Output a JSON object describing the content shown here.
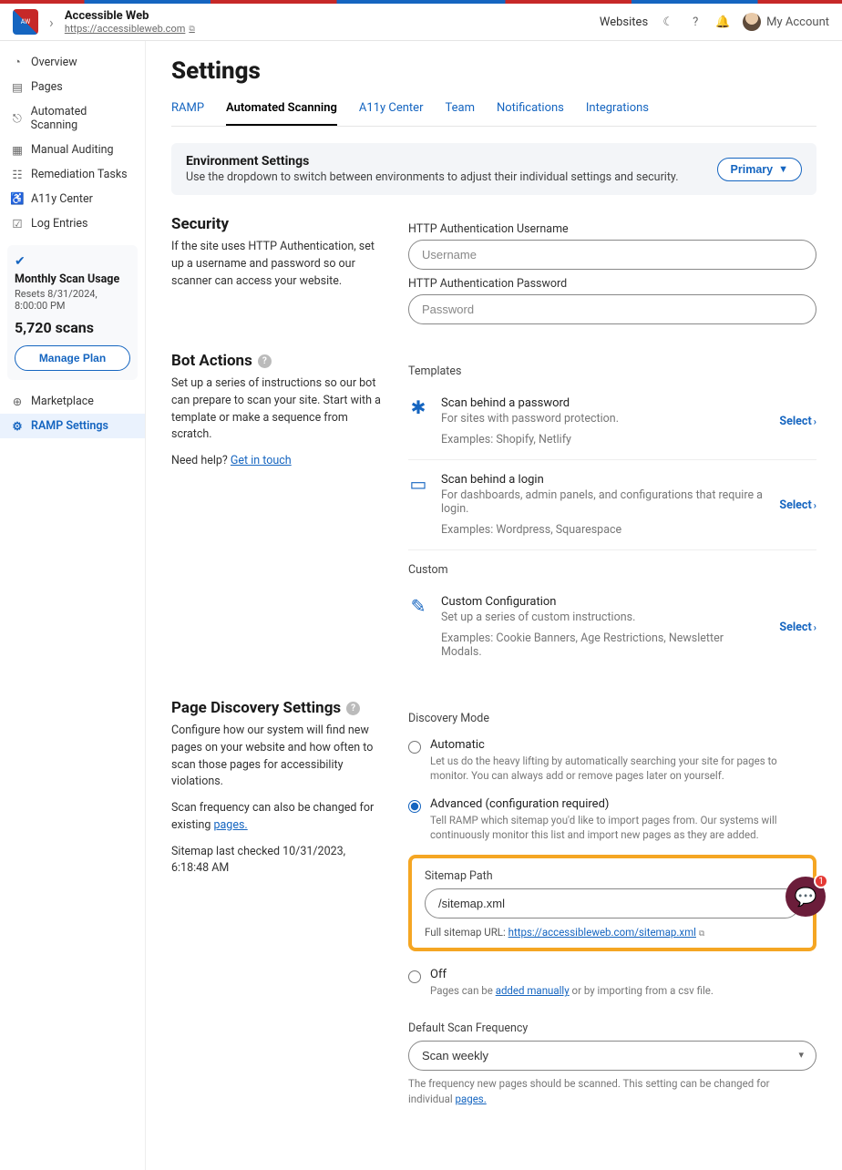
{
  "header": {
    "site_name": "Accessible Web",
    "site_url": "https://accessibleweb.com",
    "websites_link": "Websites",
    "my_account": "My Account"
  },
  "sidebar": {
    "items": [
      {
        "label": "Overview",
        "icon": "◔"
      },
      {
        "label": "Pages",
        "icon": "▤"
      },
      {
        "label": "Automated Scanning",
        "icon": "⎋"
      },
      {
        "label": "Manual Auditing",
        "icon": "▦"
      },
      {
        "label": "Remediation Tasks",
        "icon": "☷"
      },
      {
        "label": "A11y Center",
        "icon": "♿"
      },
      {
        "label": "Log Entries",
        "icon": "☑"
      }
    ],
    "marketplace": "Marketplace",
    "ramp_settings": "RAMP Settings",
    "usage": {
      "title": "Monthly Scan Usage",
      "resets": "Resets 8/31/2024, 8:00:00 PM",
      "scans": "5,720 scans",
      "manage": "Manage Plan"
    }
  },
  "page": {
    "title": "Settings",
    "tabs": [
      "RAMP",
      "Automated Scanning",
      "A11y Center",
      "Team",
      "Notifications",
      "Integrations"
    ],
    "active_tab": "Automated Scanning",
    "env": {
      "title": "Environment Settings",
      "desc": "Use the dropdown to switch between environments to adjust their individual settings and security.",
      "btn": "Primary"
    },
    "security": {
      "title": "Security",
      "desc": "If the site uses HTTP Authentication, set up a username and password so our scanner can access your website.",
      "user_label": "HTTP Authentication Username",
      "user_ph": "Username",
      "pass_label": "HTTP Authentication Password",
      "pass_ph": "Password"
    },
    "bot": {
      "title": "Bot Actions",
      "desc": "Set up a series of instructions so our bot can prepare to scan your site. Start with a template or make a sequence from scratch.",
      "help_prefix": "Need help? ",
      "help_link": "Get in touch",
      "templates_label": "Templates",
      "custom_label": "Custom",
      "select": "Select",
      "templates": [
        {
          "title": "Scan behind a password",
          "desc": "For sites with password protection.",
          "ex": "Examples: Shopify, Netlify",
          "icon": "✱"
        },
        {
          "title": "Scan behind a login",
          "desc": "For dashboards, admin panels, and configurations that require a login.",
          "ex": "Examples: Wordpress, Squarespace",
          "icon": "▭"
        }
      ],
      "custom": {
        "title": "Custom Configuration",
        "desc": "Set up a series of custom instructions.",
        "ex": "Examples: Cookie Banners, Age Restrictions, Newsletter Modals.",
        "icon": "✎"
      }
    },
    "discovery": {
      "title": "Page Discovery Settings",
      "desc": "Configure how our system will find new pages on your website and how often to scan those pages for accessibility violations.",
      "freq_note_prefix": "Scan frequency can also be changed for existing ",
      "freq_note_link": "pages.",
      "sitemap_checked": "Sitemap last checked 10/31/2023, 6:18:48 AM",
      "mode_label": "Discovery Mode",
      "automatic": {
        "title": "Automatic",
        "desc": "Let us do the heavy lifting by automatically searching your site for pages to monitor. You can always add or remove pages later on yourself."
      },
      "advanced": {
        "title": "Advanced (configuration required)",
        "desc": "Tell RAMP which sitemap you'd like to import pages from. Our systems will continuously monitor this list and import new pages as they are added."
      },
      "off": {
        "title": "Off",
        "desc_prefix": "Pages can be ",
        "desc_link": "added manually",
        "desc_suffix": " or by importing from a csv file."
      },
      "sitemap": {
        "label": "Sitemap Path",
        "value": "/sitemap.xml",
        "full_prefix": "Full sitemap URL: ",
        "full_url": "https://accessibleweb.com/sitemap.xml"
      },
      "default_freq_label": "Default Scan Frequency",
      "default_freq_value": "Scan weekly",
      "default_freq_note_prefix": "The frequency new pages should be scanned. This setting can be changed for individual ",
      "default_freq_note_link": "pages."
    }
  },
  "chat_badge": "1"
}
